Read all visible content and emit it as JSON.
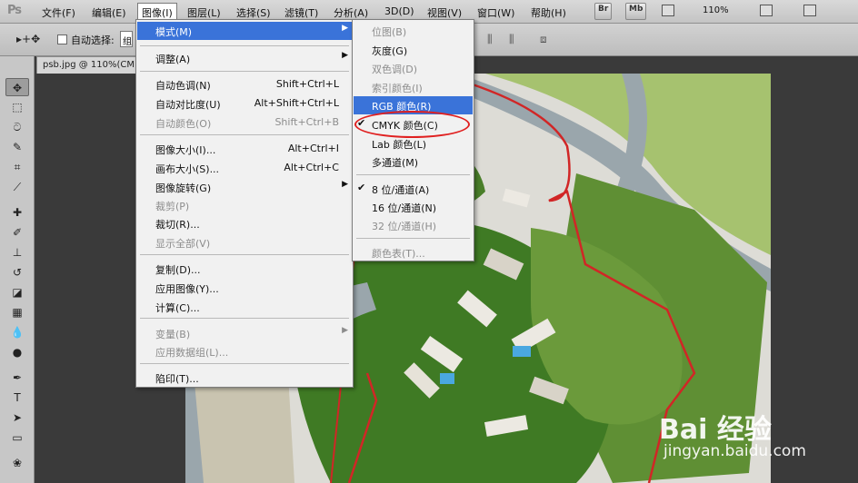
{
  "menubar": {
    "logo": "Ps",
    "items": [
      "文件(F)",
      "编辑(E)",
      "图像(I)",
      "图层(L)",
      "选择(S)",
      "滤镜(T)",
      "分析(A)",
      "3D(D)",
      "视图(V)",
      "窗口(W)",
      "帮助(H)"
    ],
    "bridge_br": "Br",
    "bridge_mb": "Mb",
    "zoom": "110%"
  },
  "options": {
    "move_glyph": "▸+✥",
    "auto_select_label": "自动选择:",
    "auto_select_value": "组"
  },
  "document": {
    "tab_title": "psb.jpg @ 110%(CM"
  },
  "image_menu": {
    "items": [
      {
        "label": "模式(M)",
        "shortcut": "",
        "submenu": true,
        "highlight": true,
        "disabled": false
      },
      {
        "label": "调整(A)",
        "shortcut": "",
        "submenu": true,
        "disabled": false
      },
      {
        "label": "自动色调(N)",
        "shortcut": "Shift+Ctrl+L",
        "disabled": false
      },
      {
        "label": "自动对比度(U)",
        "shortcut": "Alt+Shift+Ctrl+L",
        "disabled": false
      },
      {
        "label": "自动颜色(O)",
        "shortcut": "Shift+Ctrl+B",
        "disabled": true
      },
      {
        "label": "图像大小(I)...",
        "shortcut": "Alt+Ctrl+I",
        "disabled": false
      },
      {
        "label": "画布大小(S)...",
        "shortcut": "Alt+Ctrl+C",
        "disabled": false
      },
      {
        "label": "图像旋转(G)",
        "shortcut": "",
        "submenu": true,
        "disabled": false
      },
      {
        "label": "裁剪(P)",
        "shortcut": "",
        "disabled": true
      },
      {
        "label": "裁切(R)...",
        "shortcut": "",
        "disabled": false
      },
      {
        "label": "显示全部(V)",
        "shortcut": "",
        "disabled": true
      },
      {
        "label": "复制(D)...",
        "shortcut": "",
        "disabled": false
      },
      {
        "label": "应用图像(Y)...",
        "shortcut": "",
        "disabled": false
      },
      {
        "label": "计算(C)...",
        "shortcut": "",
        "disabled": false
      },
      {
        "label": "变量(B)",
        "shortcut": "",
        "submenu": true,
        "disabled": true
      },
      {
        "label": "应用数据组(L)...",
        "shortcut": "",
        "disabled": true
      },
      {
        "label": "陷印(T)...",
        "shortcut": "",
        "disabled": false
      }
    ]
  },
  "mode_menu": {
    "items": [
      {
        "label": "位图(B)",
        "disabled": true
      },
      {
        "label": "灰度(G)",
        "disabled": false
      },
      {
        "label": "双色调(D)",
        "disabled": true
      },
      {
        "label": "索引颜色(I)",
        "disabled": true
      },
      {
        "label": "RGB 颜色(R)",
        "disabled": false,
        "highlight": true
      },
      {
        "label": "CMYK 颜色(C)",
        "disabled": false,
        "checked": true
      },
      {
        "label": "Lab 颜色(L)",
        "disabled": false
      },
      {
        "label": "多通道(M)",
        "disabled": false
      },
      {
        "label": "8 位/通道(A)",
        "disabled": false,
        "checked": true
      },
      {
        "label": "16 位/通道(N)",
        "disabled": false
      },
      {
        "label": "32 位/通道(H)",
        "disabled": true
      },
      {
        "label": "颜色表(T)...",
        "disabled": true
      }
    ]
  },
  "watermark": {
    "brand": "Bai 经验",
    "url": "jingyan.baidu.com"
  },
  "colors": {
    "highlight": "#3a73d9",
    "annotation": "#e02020"
  }
}
